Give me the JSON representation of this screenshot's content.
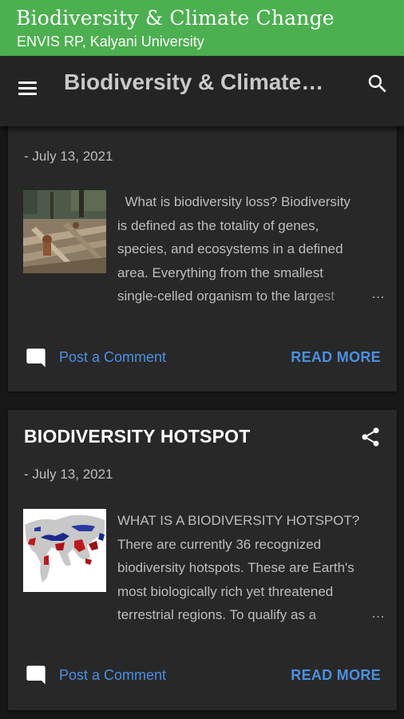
{
  "topbar": {
    "title": "Biodiversity & Climate Change",
    "subtitle": "ENVIS RP, Kalyani University",
    "color": "#4cb050"
  },
  "appbar": {
    "title": "Biodiversity & Climate Change",
    "menu_icon": "menu-icon",
    "search_icon": "search-icon"
  },
  "posts": [
    {
      "title": "",
      "date": "- July 13, 2021",
      "thumbnail": "deforestation-photo",
      "snippet_lines": [
        "  What is biodiversity loss? Biodiversity",
        "is defined as the totality of genes,",
        "species, and ecosystems in a defined",
        "area. Everything from the smallest",
        "single-celled organism to the largest"
      ],
      "ellipsis": "…",
      "comment_label": "Post a Comment",
      "read_more_label": "READ MORE"
    },
    {
      "title": "BIODIVERSITY HOTSPOT",
      "date": "- July 13, 2021",
      "thumbnail": "hotspot-map",
      "snippet_lines": [
        "WHAT IS A BIODIVERSITY HOTSPOT?",
        "There are currently 36 recognized",
        "biodiversity hotspots. These are Earth's",
        "most biologically rich yet threatened",
        "terrestrial regions. To qualify as a"
      ],
      "ellipsis": "…",
      "comment_label": "Post a Comment",
      "read_more_label": "READ MORE",
      "share_icon": "share-icon"
    }
  ],
  "colors": {
    "background": "#171717",
    "card": "#282828",
    "link": "#4a90e2"
  }
}
